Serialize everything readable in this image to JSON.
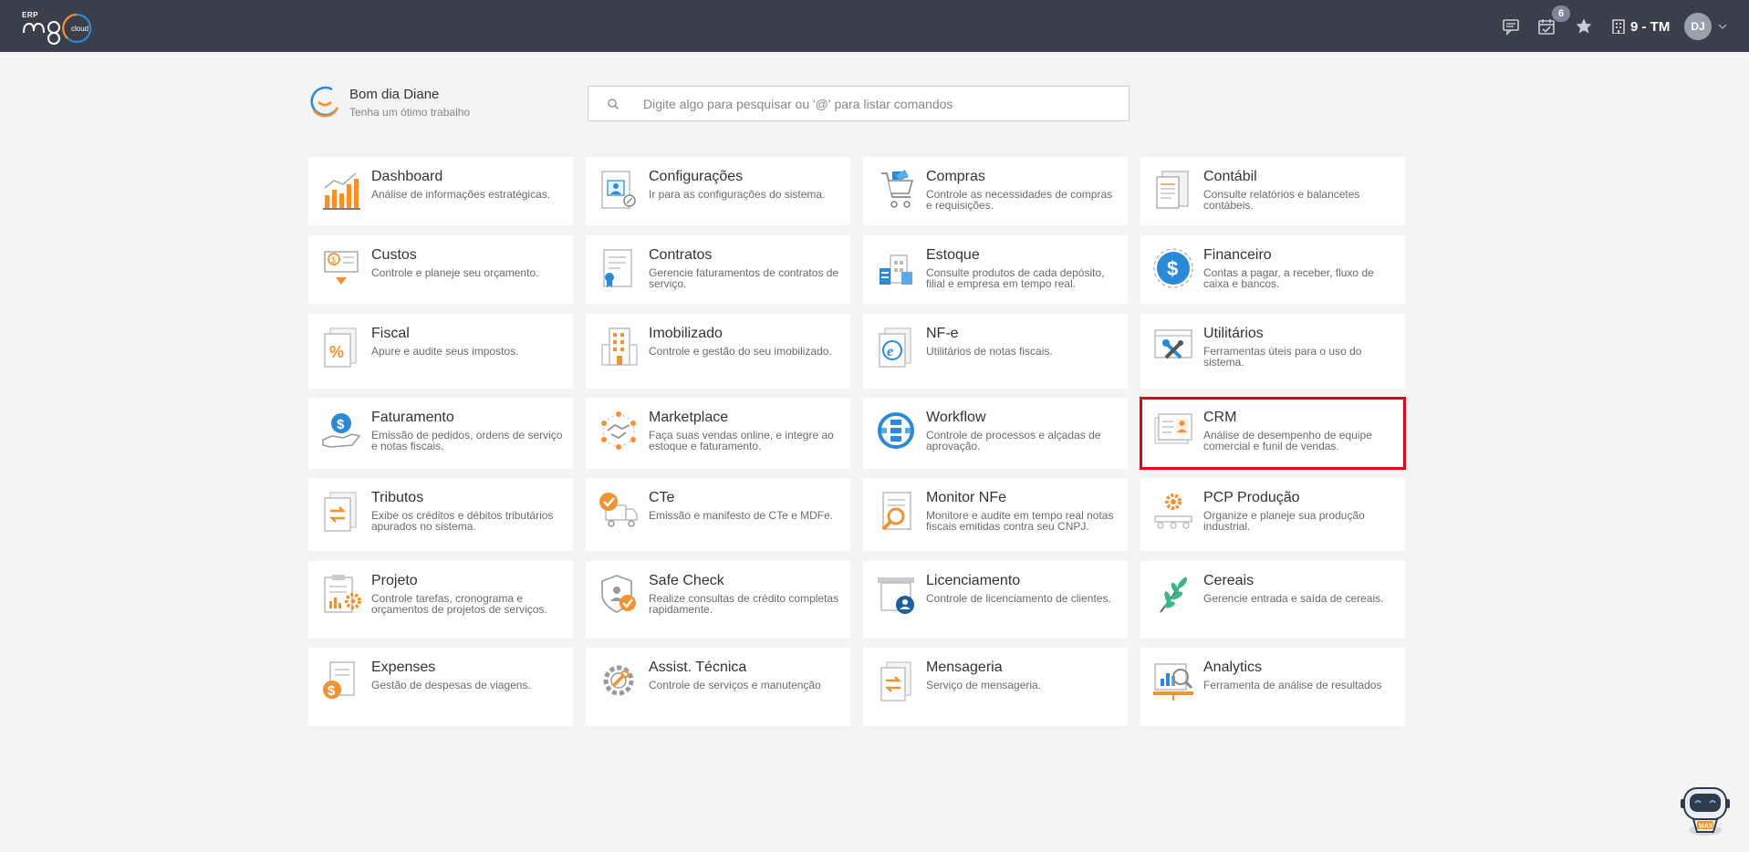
{
  "app": {
    "logo_erp": "ERP",
    "logo_main": "m8",
    "logo_cloud": "cloud"
  },
  "topbar": {
    "calendar_badge": "6",
    "company": "9 - TM",
    "user_initials": "DJ"
  },
  "greeting": {
    "title": "Bom dia Diane",
    "subtitle": "Tenha um ótimo trabalho"
  },
  "search": {
    "placeholder": "Digite algo para pesquisar ou '@' para listar comandos",
    "value": ""
  },
  "modules": [
    {
      "title": "Dashboard",
      "desc": "Análise de informações estratégicas.",
      "icon": "bar-chart-icon"
    },
    {
      "title": "Configurações",
      "desc": "Ir para as configurações do sistema.",
      "icon": "settings-profile-icon"
    },
    {
      "title": "Compras",
      "desc": "Controle as necessidades de compras e requisições.",
      "icon": "shopping-cart-icon"
    },
    {
      "title": "Contábil",
      "desc": "Consulte relatórios e balancetes contábeis.",
      "icon": "ledger-icon"
    },
    {
      "title": "Custos",
      "desc": "Controle e planeje seu orçamento.",
      "icon": "cost-icon"
    },
    {
      "title": "Contratos",
      "desc": "Gerencie faturamentos de contratos de serviço.",
      "icon": "contract-icon"
    },
    {
      "title": "Estoque",
      "desc": "Consulte produtos de cada depósito, filial e empresa em tempo real.",
      "icon": "warehouse-icon"
    },
    {
      "title": "Financeiro",
      "desc": "Contas a pagar, a receber, fluxo de caixa e bancos.",
      "icon": "dollar-coin-icon"
    },
    {
      "title": "Fiscal",
      "desc": "Apure e audite seus impostos.",
      "icon": "tax-percent-icon"
    },
    {
      "title": "Imobilizado",
      "desc": "Controle e gestão do seu imobilizado.",
      "icon": "building-icon"
    },
    {
      "title": "NF-e",
      "desc": "Utilitários de notas fiscais.",
      "icon": "e-invoice-icon"
    },
    {
      "title": "Utilitários",
      "desc": "Ferramentas úteis para o uso do sistema.",
      "icon": "tools-icon"
    },
    {
      "title": "Faturamento",
      "desc": "Emissão de pedidos, ordens de serviço e notas fiscais.",
      "icon": "billing-hand-icon"
    },
    {
      "title": "Marketplace",
      "desc": "Faça suas vendas online, e integre ao estoque e faturamento.",
      "icon": "handshake-icon"
    },
    {
      "title": "Workflow",
      "desc": "Controle de processos e alçadas de aprovação.",
      "icon": "workflow-icon"
    },
    {
      "title": "CRM",
      "desc": "Análise de desempenho de equipe comercial e funil de vendas.",
      "icon": "crm-profile-icon"
    },
    {
      "title": "Tributos",
      "desc": "Exibe os créditos e débitos tributários apurados no sistema.",
      "icon": "tax-exchange-icon"
    },
    {
      "title": "CTe",
      "desc": "Emissão e manifesto de CTe e MDFe.",
      "icon": "truck-check-icon"
    },
    {
      "title": "Monitor NFe",
      "desc": "Monitore e audite em tempo real notas fiscais emitidas contra seu CNPJ.",
      "icon": "magnifier-document-icon"
    },
    {
      "title": "PCP Produção",
      "desc": "Organize e planeje sua produção industrial.",
      "icon": "production-gear-icon"
    },
    {
      "title": "Projeto",
      "desc": "Controle tarefas, cronograma e orçamentos de projetos de serviços.",
      "icon": "project-clipboard-icon"
    },
    {
      "title": "Safe Check",
      "desc": "Realize consultas de crédito completas rapidamente.",
      "icon": "shield-check-icon"
    },
    {
      "title": "Licenciamento",
      "desc": "Controle de licenciamento de clientes.",
      "icon": "license-store-icon"
    },
    {
      "title": "Cereais",
      "desc": "Gerencie entrada e saída de cereais.",
      "icon": "leaf-icon"
    },
    {
      "title": "Expenses",
      "desc": "Gestão de despesas de viagens.",
      "icon": "expenses-icon"
    },
    {
      "title": "Assist. Técnica",
      "desc": "Controle de serviços e manutenção",
      "icon": "wrench-gear-icon"
    },
    {
      "title": "Mensageria",
      "desc": "Serviço de mensageria.",
      "icon": "messaging-icon"
    },
    {
      "title": "Analytics",
      "desc": "Ferramenta de análise de resultados",
      "icon": "analytics-board-icon"
    }
  ],
  "assistant": {
    "label": "MAX"
  },
  "colors": {
    "topbar": "#3a3f4b",
    "accent_orange": "#f39233",
    "accent_blue": "#2b8ad8",
    "selected_outline": "#e0001b"
  }
}
